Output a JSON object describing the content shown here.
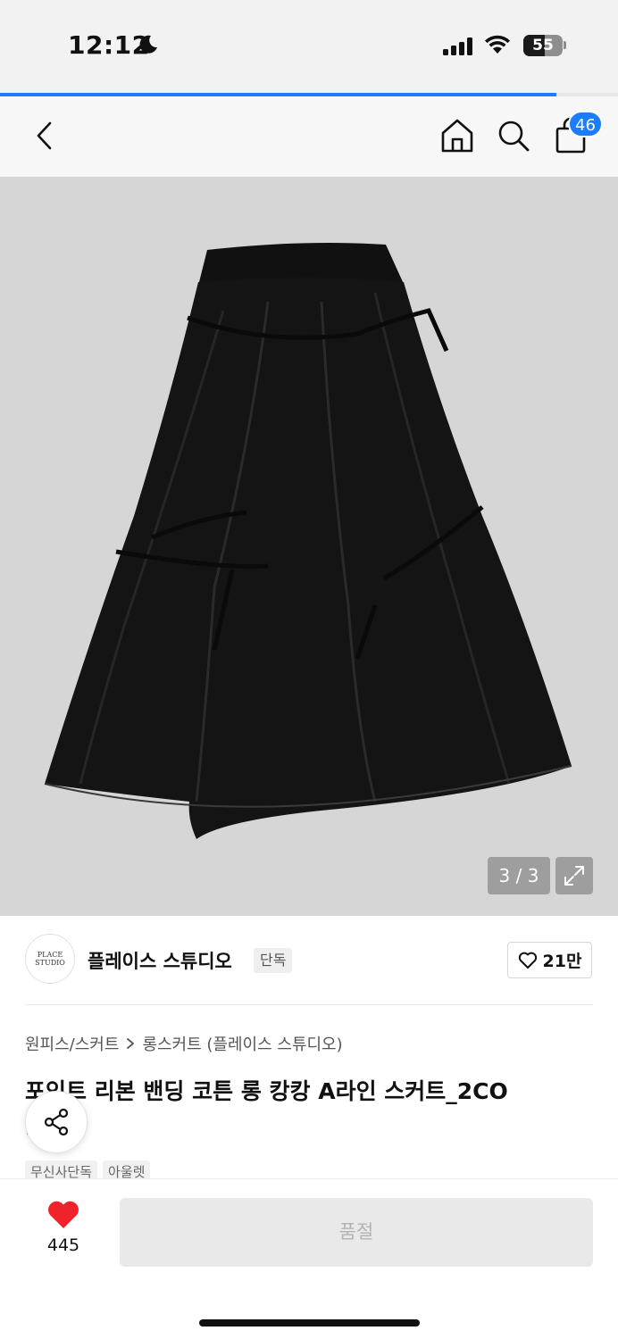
{
  "status_bar": {
    "time": "12:12",
    "battery": "55"
  },
  "load_progress": 0.9,
  "nav": {
    "back_icon": "chevron-left-icon",
    "home_icon": "home-icon",
    "search_icon": "search-icon",
    "cart_icon": "shopping-bag-icon",
    "cart_count": "46"
  },
  "gallery": {
    "counter": "3 / 3",
    "expand_icon": "expand-icon"
  },
  "brand": {
    "logo_text": [
      "PLACE",
      "STUDIO"
    ],
    "name": "플레이스 스튜디오",
    "tag": "단독",
    "likes": "21만"
  },
  "breadcrumb": {
    "category": "원피스/스커트",
    "subcategory": "롱스커트 (플레이스 스튜디오)"
  },
  "product": {
    "title": "포인트 리본 밴딩 코튼 롱 캉캉 A라인 스커트_2CO",
    "title_line2": "L",
    "tags": [
      "무신사단독",
      "아울렛"
    ]
  },
  "bottom": {
    "wish_count": "445",
    "buy_label": "품절"
  },
  "colors": {
    "accent": "#1a7dff",
    "heart": "#f0232b",
    "disabled_btn": "#e9e9e9"
  }
}
